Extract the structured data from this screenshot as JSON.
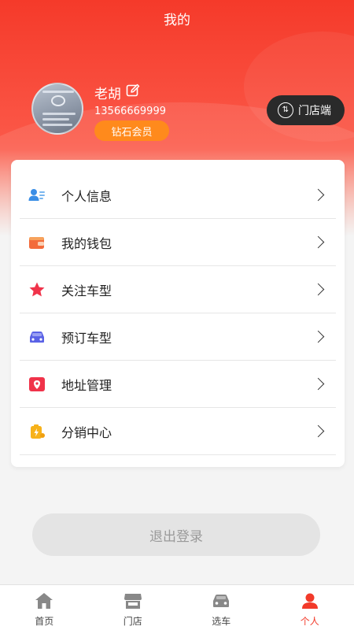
{
  "title": "我的",
  "profile": {
    "name": "老胡",
    "phone": "13566669999",
    "member_level": "钻石会员"
  },
  "store_button": {
    "label": "门店端",
    "icon": "switch-icon"
  },
  "menu": [
    {
      "label": "个人信息",
      "icon": "user-card-icon",
      "color": "#3a8ee6"
    },
    {
      "label": "我的钱包",
      "icon": "wallet-icon",
      "color": "#f36b3b"
    },
    {
      "label": "关注车型",
      "icon": "star-icon",
      "color": "#f0334a"
    },
    {
      "label": "预订车型",
      "icon": "car-icon",
      "color": "#5a62e6"
    },
    {
      "label": "地址管理",
      "icon": "map-pin-icon",
      "color": "#f0334a"
    },
    {
      "label": "分销中心",
      "icon": "battery-bolt-icon",
      "color": "#f7b21a"
    }
  ],
  "logout_label": "退出登录",
  "tabs": [
    {
      "label": "首页",
      "icon": "home-icon",
      "active": false
    },
    {
      "label": "门店",
      "icon": "store-icon",
      "active": false
    },
    {
      "label": "选车",
      "icon": "car-icon",
      "active": false
    },
    {
      "label": "个人",
      "icon": "person-icon",
      "active": true
    }
  ],
  "colors": {
    "primary": "#f23a2a",
    "badge": "#ff8a1c"
  }
}
